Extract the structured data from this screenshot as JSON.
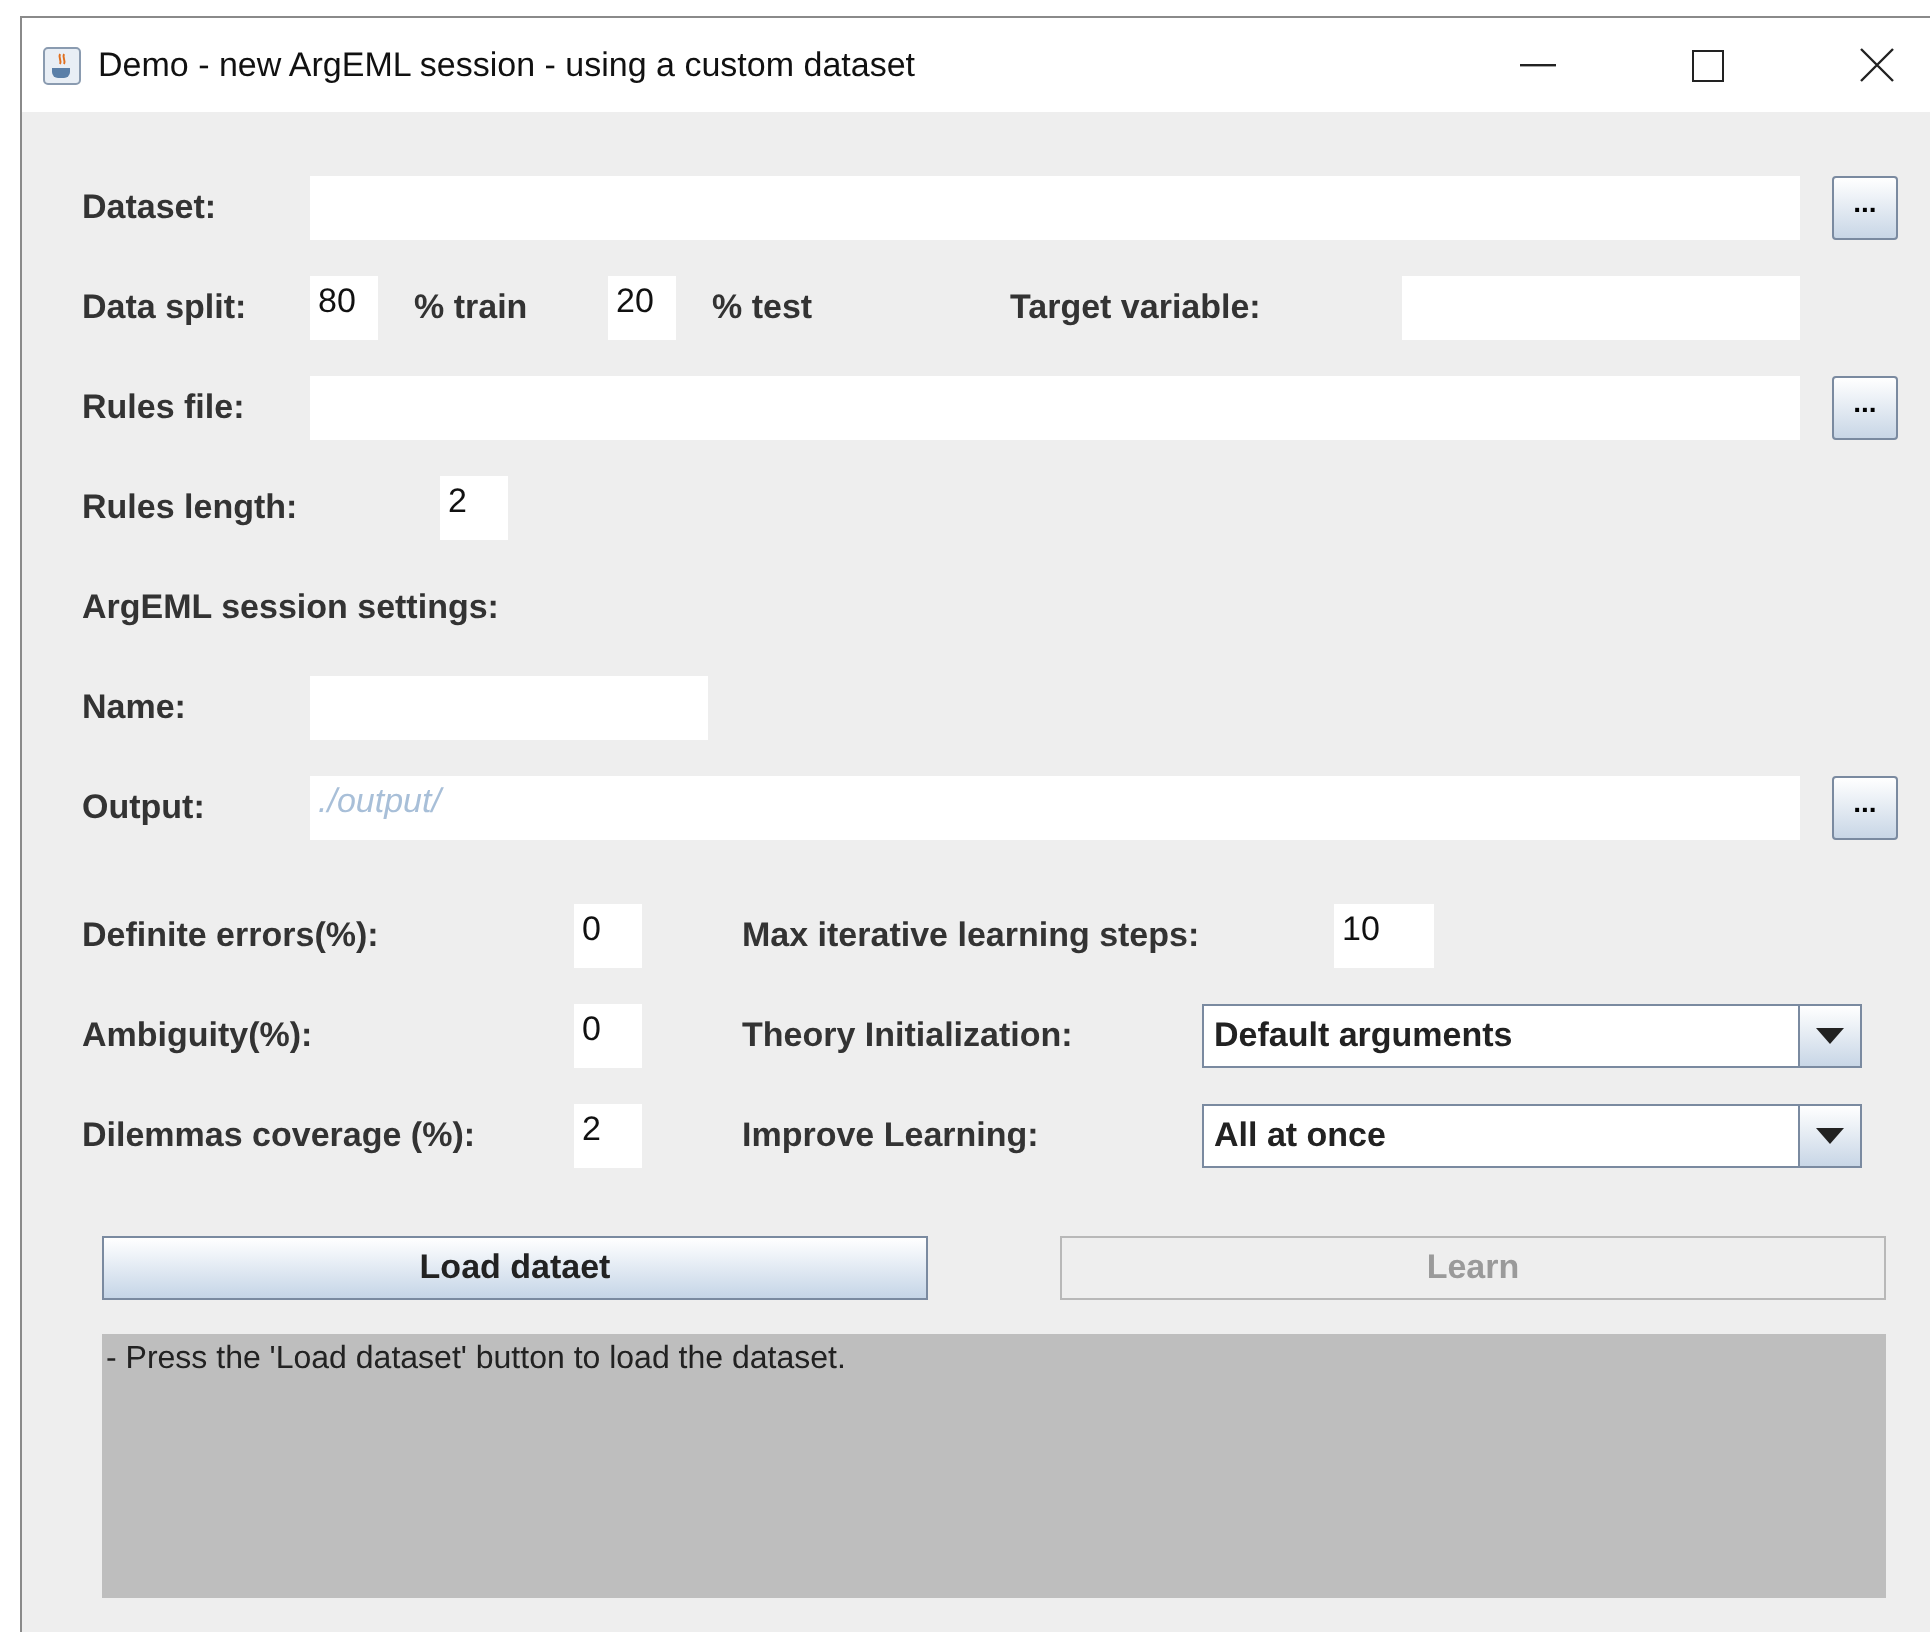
{
  "window": {
    "title": "Demo - new ArgEML session - using a custom dataset"
  },
  "dataset": {
    "label": "Dataset:",
    "browse": "..."
  },
  "split": {
    "label": "Data split:",
    "train": "80",
    "train_label": "% train",
    "test": "20",
    "test_label": "% test",
    "target_label": "Target variable:"
  },
  "rules_file": {
    "label": "Rules file:",
    "browse": "..."
  },
  "rules_length": {
    "label": "Rules length:",
    "value": "2"
  },
  "session_heading": "ArgEML session settings:",
  "name": {
    "label": "Name:"
  },
  "output": {
    "label": "Output:",
    "placeholder": "./output/",
    "browse": "..."
  },
  "params": [
    {
      "label": "Definite errors(%):",
      "value": "0",
      "right_label": "Max iterative learning steps:",
      "kind": "text",
      "right_value": "10"
    },
    {
      "label": "Ambiguity(%):",
      "value": "0",
      "right_label": "Theory Initialization:",
      "kind": "combo",
      "right_value": "Default arguments"
    },
    {
      "label": "Dilemmas coverage (%):",
      "value": "2",
      "right_label": "Improve Learning:",
      "kind": "combo",
      "right_value": "All at once"
    }
  ],
  "buttons": [
    {
      "label": "Load dataet",
      "disabled": false
    },
    {
      "label": "Learn",
      "disabled": true
    }
  ],
  "log": "- Press the 'Load dataset' button to load the dataset."
}
